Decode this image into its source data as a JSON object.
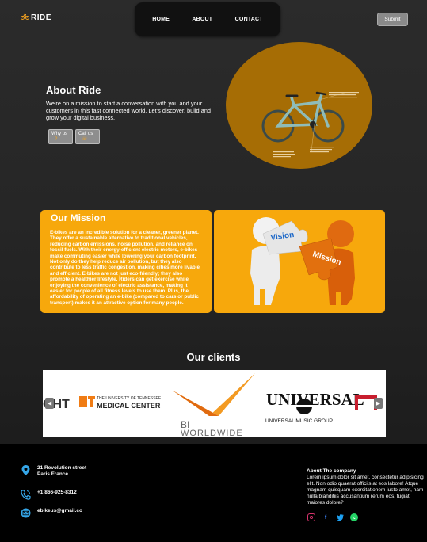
{
  "header": {
    "logo_text": "RIDE",
    "nav": [
      "HOME",
      "ABOUT",
      "CONTACT"
    ],
    "submit_label": "Submit"
  },
  "about": {
    "title": "About Ride",
    "text": "We're on a mission to start a conversation with you and your customers in this fast connected world. Let's discover, build and grow your digital business.",
    "why_label": "Why us",
    "call_label": "Call us"
  },
  "mission": {
    "title": "Our Mission",
    "text": "E-bikes are an incredible solution for a cleaner, greener planet. They offer a sustainable alternative to traditional vehicles, reducing carbon emissions, noise pollution, and reliance on fossil fuels. With their energy-efficient electric motors, e-bikes make commuting easier while lowering your carbon footprint. Not only do they help reduce air pollution, but they also contribute to less traffic congestion, making cities more livable and efficient. E-bikes are not just eco-friendly; they also promote a healthier lifestyle. Riders can get exercise while enjoying the convenience of electric assistance, making it easier for people of all fitness levels to use them. Plus, the affordability of operating an e-bike (compared to cars or public transport) makes it an attractive option for many people.",
    "puzzle_left": "Vision",
    "puzzle_right": "Mission"
  },
  "clients": {
    "title": "Our clients",
    "logos": {
      "partial_left": "GHT",
      "ut_small": "THE UNIVERSITY OF TENNESSEE",
      "ut_big": "MEDICAL CENTER",
      "bi_line1": "BI",
      "bi_line2": "WORLDWIDE",
      "universal_big": "UNIVERSAL",
      "universal_small": "UNIVERSAL MUSIC GROUP"
    },
    "prev_arrow": "◀",
    "next_arrow": "▶"
  },
  "footer": {
    "address_line1": "21 Revolution street",
    "address_line2": "Paris France",
    "phone": "+1 866-925-8312",
    "email": "ebikeus@gmail.co",
    "about_heading": "About The company",
    "about_text": "Lorem ipsum dolor sit amet, consectetur adipisicing elit. Non odio quaerat officiis at eos labore! Atque magnam quisquam exercitationem iusto amet, nam nulla blanditiis accusantium rerum eos, fugiat maiores dolore?",
    "social_icons": [
      "instagram-icon",
      "facebook-icon",
      "twitter-icon",
      "whatsapp-icon"
    ]
  },
  "colors": {
    "accent": "#f7a80c",
    "circle": "#a66d05",
    "footer_bg": "#000000"
  }
}
